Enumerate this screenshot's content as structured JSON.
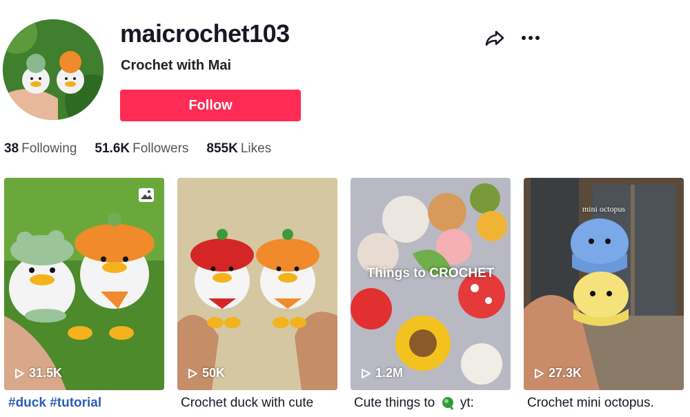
{
  "profile": {
    "username": "maicrochet103",
    "nickname": "Crochet with Mai",
    "follow_label": "Follow"
  },
  "stats": [
    {
      "value": "38",
      "label": "Following"
    },
    {
      "value": "51.6K",
      "label": "Followers"
    },
    {
      "value": "855K",
      "label": "Likes"
    }
  ],
  "icons": {
    "share": "share-icon",
    "more": "more-icon",
    "play": "play-icon",
    "photo": "photo-icon",
    "sprout": "green-sprout-icon"
  },
  "videos": [
    {
      "views": "31.5K",
      "caption": "#duck #tutorial",
      "is_tag": true
    },
    {
      "views": "50K",
      "caption": "Crochet duck with cute"
    },
    {
      "views": "1.2M",
      "caption_before": "Cute things to",
      "caption_after": "yt:",
      "overlay": "Things to CROCHET"
    },
    {
      "views": "27.3K",
      "caption": "Crochet mini octopus.",
      "overlay": "mini octopus"
    }
  ],
  "colors": {
    "accent": "#fe2c55",
    "hashtag": "#2b5db9"
  }
}
